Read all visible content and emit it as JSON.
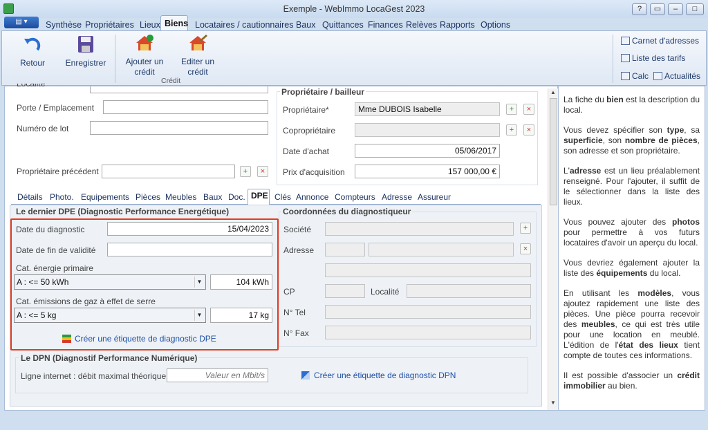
{
  "app": {
    "title": "Exemple - WebImmo LocaGest 2023"
  },
  "ribbon_tabs": [
    "Synthèse",
    "Propriétaires",
    "Lieux",
    "Biens",
    "Locataires / cautionnaires",
    "Baux",
    "Quittances",
    "Finances",
    "Relèves",
    "Rapports",
    "Options"
  ],
  "active_ribbon_tab": "Biens",
  "ribbon": {
    "retour": "Retour",
    "enregistrer": "Enregistrer",
    "ajouter_line1": "Ajouter un",
    "ajouter_line2": "crédit",
    "editer_line1": "Editer un",
    "editer_line2": "crédit",
    "group_label": "Crédit",
    "carnet": "Carnet d'adresses",
    "tarifs": "Liste des tarifs",
    "calc": "Calc",
    "actualites": "Actualités"
  },
  "top_form": {
    "localite_cut": "Localité",
    "porte_label": "Porte / Emplacement",
    "lot_label": "Numéro de lot",
    "prev_owner_label": "Propriétaire précédent"
  },
  "owner": {
    "title": "Propriétaire / bailleur",
    "proprietaire_label": "Propriétaire*",
    "proprietaire_value": "Mme DUBOIS Isabelle",
    "coproprietaire_label": "Copropriétaire",
    "date_achat_label": "Date d'achat",
    "date_achat_value": "05/06/2017",
    "prix_label": "Prix d'acquisition",
    "prix_value": "157 000,00 €"
  },
  "sub_tabs": [
    "Détails",
    "Photo.",
    "Equipements",
    "Pièces",
    "Meubles",
    "Baux",
    "Doc.",
    "DPE",
    "Clés",
    "Annonce",
    "Compteurs",
    "Adresse",
    "Assureur"
  ],
  "active_sub_tab": "DPE",
  "dpe": {
    "title": "Le dernier DPE (Diagnostic Performance Energétique)",
    "date_diag_label": "Date du diagnostic",
    "date_diag_value": "15/04/2023",
    "date_fin_label": "Date de fin de validité",
    "cat_energie_label": "Cat. énergie primaire",
    "cat_energie_value": "A : <= 50 kWh",
    "energie_amount": "104 kWh",
    "cat_gaz_label": "Cat. émissions de gaz à effet de serre",
    "cat_gaz_value": "A : <= 5 kg",
    "gaz_amount": "17 kg",
    "create_label": "Créer une étiquette de diagnostic DPE"
  },
  "diagnostiqueur": {
    "title": "Coordonnées du diagnostiqueur",
    "societe_label": "Société",
    "adresse_label": "Adresse",
    "cp_label": "CP",
    "localite_label": "Localité",
    "tel_label": "N° Tel",
    "fax_label": "N° Fax"
  },
  "dpn": {
    "title": "Le DPN (Diagnostif Performance Numérique)",
    "ligne_label": "Ligne internet : débit maximal théorique",
    "ligne_placeholder": "Valeur en Mbit/s",
    "create_label": "Créer une étiquette de diagnostic DPN"
  },
  "help": [
    [
      "La fiche du ",
      "bien",
      " est la description du local."
    ],
    [
      "Vous devez spécifier son ",
      "type",
      ", sa ",
      "superficie",
      ", son ",
      "nombre de pièces",
      ", son adresse et son propriétaire."
    ],
    [
      "L'",
      "adresse",
      " est un lieu préalablement renseigné. Pour l'ajouter, il suffit de le sélectionner dans la liste des lieux."
    ],
    [
      "Vous pouvez ajouter des ",
      "photos",
      " pour permettre à vos futurs locataires d'avoir un aperçu du local."
    ],
    [
      "Vous devriez également ajouter la liste des ",
      "équipements",
      " du local."
    ],
    [
      "En utilisant les ",
      "modèles",
      ", vous ajoutez rapidement une liste des pièces. Une pièce pourra recevoir des ",
      "meubles",
      ", ce qui est très utile pour une location en meublé. L'édition de l'",
      "état des lieux",
      " tient compte de toutes ces informations."
    ],
    [
      "Il est possible d'associer un ",
      "crédit immobilier",
      " au bien."
    ]
  ]
}
